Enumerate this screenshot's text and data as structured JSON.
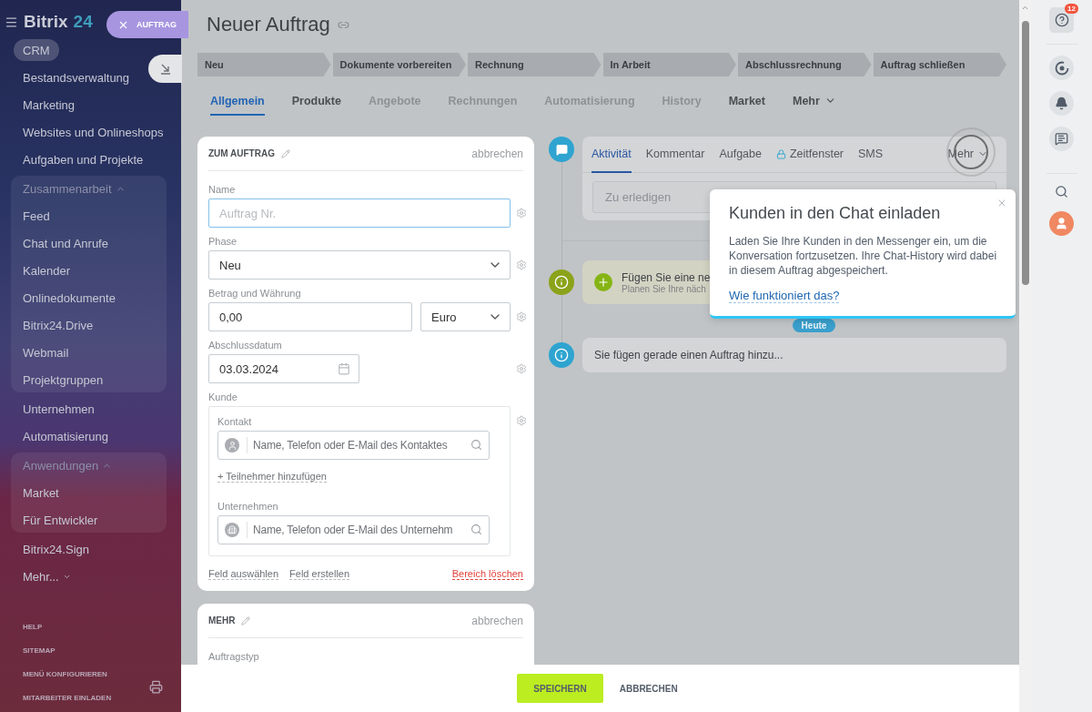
{
  "sidebar": {
    "logo": {
      "name": "Bitrix",
      "number": "24"
    },
    "items": [
      {
        "kind": "link",
        "label": "CRM",
        "selected": true
      },
      {
        "kind": "link",
        "label": "Bestandsverwaltung",
        "selected": false
      },
      {
        "kind": "link",
        "label": "Marketing",
        "selected": false
      },
      {
        "kind": "link",
        "label": "Websites und Onlineshops",
        "selected": false
      },
      {
        "kind": "link",
        "label": "Aufgaben und Projekte",
        "selected": false
      },
      {
        "kind": "group",
        "label": "Zusammenarbeit",
        "expanded": true,
        "children": [
          {
            "label": "Feed",
            "selected": false
          },
          {
            "label": "Chat und Anrufe",
            "selected": false
          },
          {
            "label": "Kalender",
            "selected": false
          },
          {
            "label": "Onlinedokumente",
            "selected": false
          },
          {
            "label": "Bitrix24.Drive",
            "selected": false
          },
          {
            "label": "Webmail",
            "selected": false
          },
          {
            "label": "Projektgruppen",
            "selected": false
          }
        ]
      },
      {
        "kind": "link",
        "label": "Unternehmen",
        "selected": false
      },
      {
        "kind": "link",
        "label": "Automatisierung",
        "selected": false
      },
      {
        "kind": "group",
        "label": "Anwendungen",
        "expanded": true,
        "children": [
          {
            "label": "Market",
            "selected": false
          },
          {
            "label": "Für Entwickler",
            "selected": false
          }
        ]
      },
      {
        "kind": "link",
        "label": "Bitrix24.Sign",
        "selected": false
      },
      {
        "kind": "more",
        "label": "Mehr...",
        "selected": false
      }
    ],
    "footer_links": [
      "HELP",
      "SITEMAP",
      "MENÜ KONFIGURIEREN",
      "MITARBEITER EINLADEN"
    ]
  },
  "slider_tab": {
    "label": "AUFTRAG"
  },
  "page": {
    "title": "Neuer Auftrag"
  },
  "stages": [
    "Neu",
    "Dokumente vorbereiten",
    "Rechnung",
    "In Arbeit",
    "Abschlussrechnung",
    "Auftrag schließen"
  ],
  "tabs": [
    {
      "kind": "tab",
      "label": "Allgemein",
      "selected": true,
      "disabled": false
    },
    {
      "kind": "tab",
      "label": "Produkte",
      "selected": false,
      "disabled": false
    },
    {
      "kind": "tab",
      "label": "Angebote",
      "selected": false,
      "disabled": true
    },
    {
      "kind": "tab",
      "label": "Rechnungen",
      "selected": false,
      "disabled": true
    },
    {
      "kind": "tab",
      "label": "Automatisierung",
      "selected": false,
      "disabled": true
    },
    {
      "kind": "tab",
      "label": "History",
      "selected": false,
      "disabled": true
    },
    {
      "kind": "tab",
      "label": "Market",
      "selected": false,
      "disabled": false
    },
    {
      "kind": "menu",
      "label": "Mehr",
      "selected": false,
      "disabled": false
    }
  ],
  "form_card": {
    "title": "ZUM AUFTRAG",
    "cancel": "abbrechen",
    "fields": [
      {
        "kind": "text",
        "label": "Name",
        "placeholder": "Auftrag Nr.",
        "focused": true
      },
      {
        "kind": "select",
        "label": "Phase",
        "value": "Neu"
      },
      {
        "kind": "money",
        "label": "Betrag und Währung",
        "value": "0,00",
        "currency": "Euro"
      },
      {
        "kind": "date",
        "label": "Abschlussdatum",
        "value": "03.03.2024"
      },
      {
        "kind": "client",
        "label": "Kunde",
        "contact_label": "Kontakt",
        "contact_placeholder": "Name, Telefon oder E-Mail des Kontaktes",
        "add_participant": "+ Teilnehmer hinzufügen",
        "company_label": "Unternehmen",
        "company_placeholder": "Name, Telefon oder E-Mail des Unternehm"
      }
    ],
    "footer_links": [
      {
        "kind": "link",
        "label": "Feld auswählen"
      },
      {
        "kind": "link",
        "label": "Feld erstellen"
      },
      {
        "kind": "danger",
        "label": "Bereich löschen"
      }
    ]
  },
  "more_card": {
    "title": "MEHR",
    "cancel": "abbrechen",
    "field_label": "Auftragstyp"
  },
  "timeline": {
    "editor_tabs": [
      {
        "kind": "tab",
        "label": "Aktivität",
        "selected": true,
        "locked": false
      },
      {
        "kind": "tab",
        "label": "Kommentar",
        "selected": false,
        "locked": false
      },
      {
        "kind": "tab",
        "label": "Aufgabe",
        "selected": false,
        "locked": false
      },
      {
        "kind": "tab",
        "label": "Zeitfenster",
        "selected": false,
        "locked": true
      },
      {
        "kind": "tab",
        "label": "SMS",
        "selected": false,
        "locked": false
      },
      {
        "kind": "menu",
        "label": "Mehr",
        "selected": false,
        "locked": false
      }
    ],
    "editor_placeholder": "Zu erledigen",
    "items": [
      {
        "kind": "todo",
        "title": "Fügen Sie eine ne",
        "subtitle": "Planen Sie Ihre näch"
      },
      {
        "kind": "date",
        "label": "Heute"
      },
      {
        "kind": "info",
        "text": "Sie fügen gerade einen Auftrag hinzu..."
      }
    ]
  },
  "popup": {
    "title": "Kunden in den Chat einladen",
    "body": "Laden Sie Ihre Kunden in den Messenger ein, um die Konversation fortzusetzen. Ihre Chat-History wird dabei in diesem Auftrag abgespeichert.",
    "link": "Wie funktioniert das?"
  },
  "bottom_bar": {
    "save": "SPEICHERN",
    "cancel": "ABBRECHEN"
  },
  "right_bar": {
    "help_badge": "12"
  }
}
